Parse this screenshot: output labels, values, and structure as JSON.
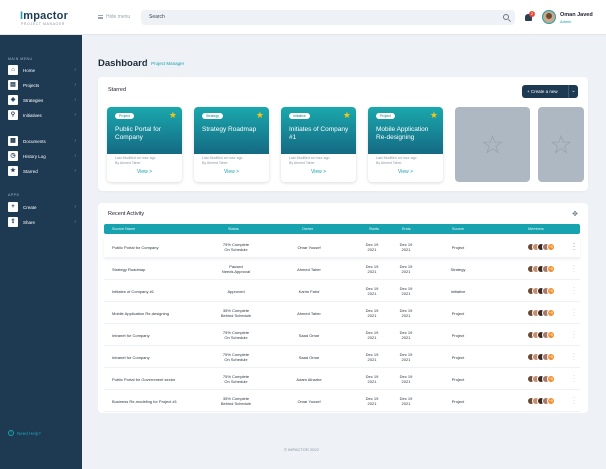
{
  "brand": {
    "name_prefix": "I",
    "name_rest": "mpactor",
    "tagline": "PROJECT MANAGER"
  },
  "topbar": {
    "hide_menu_label": "Hide menu",
    "search_placeholder": "Search",
    "notification_count": "2",
    "user": {
      "name": "Oman Javed",
      "role": "Admin"
    }
  },
  "sidebar": {
    "main_menu_label": "MAIN MENU",
    "main_items": [
      {
        "label": "Home",
        "icon": "home-icon",
        "glyph": "⌂"
      },
      {
        "label": "Projects",
        "icon": "projects-icon",
        "glyph": "▤"
      },
      {
        "label": "Strategies",
        "icon": "strategies-icon",
        "glyph": "◈"
      },
      {
        "label": "Initiatives",
        "icon": "initiatives-icon",
        "glyph": "⚲"
      }
    ],
    "secondary_items": [
      {
        "label": "Documents",
        "icon": "documents-icon",
        "glyph": "▦"
      },
      {
        "label": "History Log",
        "icon": "history-icon",
        "glyph": "◷"
      },
      {
        "label": "Starred",
        "icon": "star-icon",
        "glyph": "★"
      }
    ],
    "apps_label": "APPS",
    "app_items": [
      {
        "label": "Create",
        "icon": "create-icon",
        "glyph": "+"
      },
      {
        "label": "Share",
        "icon": "share-icon",
        "glyph": "⇪"
      }
    ],
    "need_help_label": "Need Help?"
  },
  "page": {
    "title": "Dashboard",
    "subtitle": "Project Manager"
  },
  "starred": {
    "title": "Starred",
    "create_label": "+ Create a new",
    "cards": [
      {
        "tag": "Project",
        "name": "Public Portal for Company",
        "modified": "Last Modified an hour ago",
        "by": "By Ahmed Taher",
        "view": "View >"
      },
      {
        "tag": "Strategy",
        "name": "Strategy Roadmap",
        "modified": "Last Modified an hour ago",
        "by": "By Ahmed Taher",
        "view": "View >"
      },
      {
        "tag": "Initiative",
        "name": "Initiates of Company #1",
        "modified": "Last Modified an hour ago",
        "by": "By Ahmed Taher",
        "view": "View >"
      },
      {
        "tag": "Project",
        "name": "Mobile Application Re-designing",
        "modified": "Last Modified an hour ago",
        "by": "By Ahmed Taher",
        "view": "View >"
      }
    ]
  },
  "activity": {
    "title": "Recent Activity",
    "columns": [
      "Source Name",
      "Status",
      "Owner",
      "Starts",
      "Ends",
      "Source",
      "Members"
    ],
    "rows": [
      {
        "name": "Public Portal for Company",
        "status1": "75% Complete",
        "status2": "On Schedule",
        "owner": "Omar Yousef",
        "start1": "Dec 19",
        "start2": "2021",
        "end1": "Dec 19",
        "end2": "2021",
        "source": "Project",
        "extra": "+5"
      },
      {
        "name": "Strategy Roadmap",
        "status1": "Paused",
        "status2": "Needs Approval",
        "owner": "Ahmed Taher",
        "start1": "Dec 19",
        "start2": "2021",
        "end1": "Dec 19",
        "end2": "2021",
        "source": "Strategy",
        "extra": "+5"
      },
      {
        "name": "Initiates of Company #1",
        "status1": "Approved",
        "status2": "",
        "owner": "Karim Fahd",
        "start1": "Dec 19",
        "start2": "2021",
        "end1": "Dec 19",
        "end2": "2021",
        "source": "Initiative",
        "extra": "+5"
      },
      {
        "name": "Mobile Application Re-designing",
        "status1": "35% Complete",
        "status2": "Behind Schedule",
        "owner": "Ahmed Taher",
        "start1": "Dec 19",
        "start2": "2021",
        "end1": "Dec 19",
        "end2": "2021",
        "source": "Project",
        "extra": "+5"
      },
      {
        "name": "Intranet for Company",
        "status1": "75% Complete",
        "status2": "On Schedule",
        "owner": "Saad Omar",
        "start1": "Dec 19",
        "start2": "2021",
        "end1": "Dec 19",
        "end2": "2021",
        "source": "Project",
        "extra": "+5"
      },
      {
        "name": "Intranet for Company",
        "status1": "75% Complete",
        "status2": "On Schedule",
        "owner": "Saad Omar",
        "start1": "Dec 19",
        "start2": "2021",
        "end1": "Dec 19",
        "end2": "2021",
        "source": "Project",
        "extra": "+5"
      },
      {
        "name": "Public Portal for Government sector",
        "status1": "75% Complete",
        "status2": "On Schedule",
        "owner": "Adam Alharbe",
        "start1": "Dec 19",
        "start2": "2021",
        "end1": "Dec 19",
        "end2": "2021",
        "source": "Project",
        "extra": "+5"
      },
      {
        "name": "Business Re-modeling for Project #1",
        "status1": "35% Complete",
        "status2": "Behind Schedule",
        "owner": "Omar Yousef",
        "start1": "Dec 19",
        "start2": "2021",
        "end1": "Dec 19",
        "end2": "2021",
        "source": "Project",
        "extra": "+5"
      }
    ]
  },
  "footer": {
    "text": "© IMPACTOR 2022"
  },
  "colors": {
    "sidebar": "#1e3a52",
    "accent": "#17a2b0",
    "star": "#f5c518",
    "badge": "#e74c3c",
    "member_extra": "#f28c28"
  }
}
